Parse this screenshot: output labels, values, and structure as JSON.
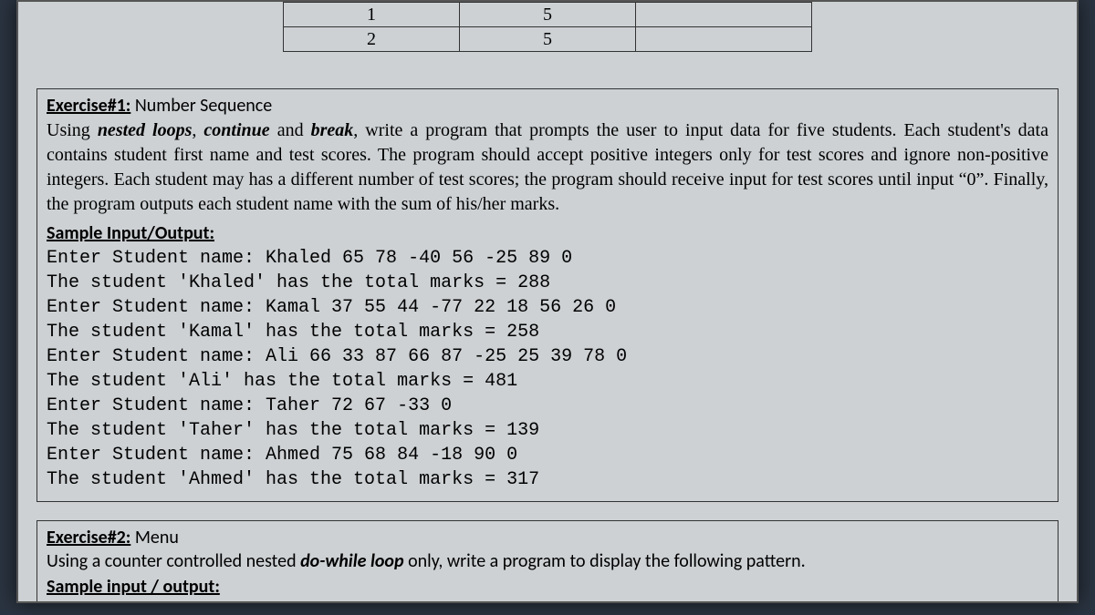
{
  "topTable": {
    "rows": [
      [
        "1",
        "5",
        ""
      ],
      [
        "2",
        "5",
        ""
      ]
    ]
  },
  "ex1": {
    "label": "Exercise#1:",
    "title": " Number Sequence",
    "instr_pre": "Using ",
    "kw1": "nested loops",
    "instr_mid1": ", ",
    "kw2": "continue",
    "instr_mid2": " and ",
    "kw3": "break",
    "instr_post": ", write a program that prompts the user to input data for five students. Each student's data contains student first name and test scores. The program should accept positive integers only for test scores and ignore non-positive integers. Each student may has a different number of test scores; the program should receive input for test scores until input “0”. Finally, the program outputs each student name with the sum of his/her marks.",
    "sample_label": "Sample Input/Output:",
    "console": "Enter Student name: Khaled 65 78 -40 56 -25 89 0\nThe student 'Khaled' has the total marks = 288\nEnter Student name: Kamal 37 55 44 -77 22 18 56 26 0\nThe student 'Kamal' has the total marks = 258\nEnter Student name: Ali 66 33 87 66 87 -25 25 39 78 0\nThe student 'Ali' has the total marks = 481\nEnter Student name: Taher 72 67 -33 0\nThe student 'Taher' has the total marks = 139\nEnter Student name: Ahmed 75 68 84 -18 90 0\nThe student 'Ahmed' has the total marks = 317"
  },
  "ex2": {
    "label": "Exercise#2:",
    "title": " Menu",
    "instr_pre": "Using a counter controlled nested ",
    "kw": "do-while loop",
    "instr_post": " only, write a program to display the following pattern.",
    "sample_label": "Sample input / output:"
  }
}
